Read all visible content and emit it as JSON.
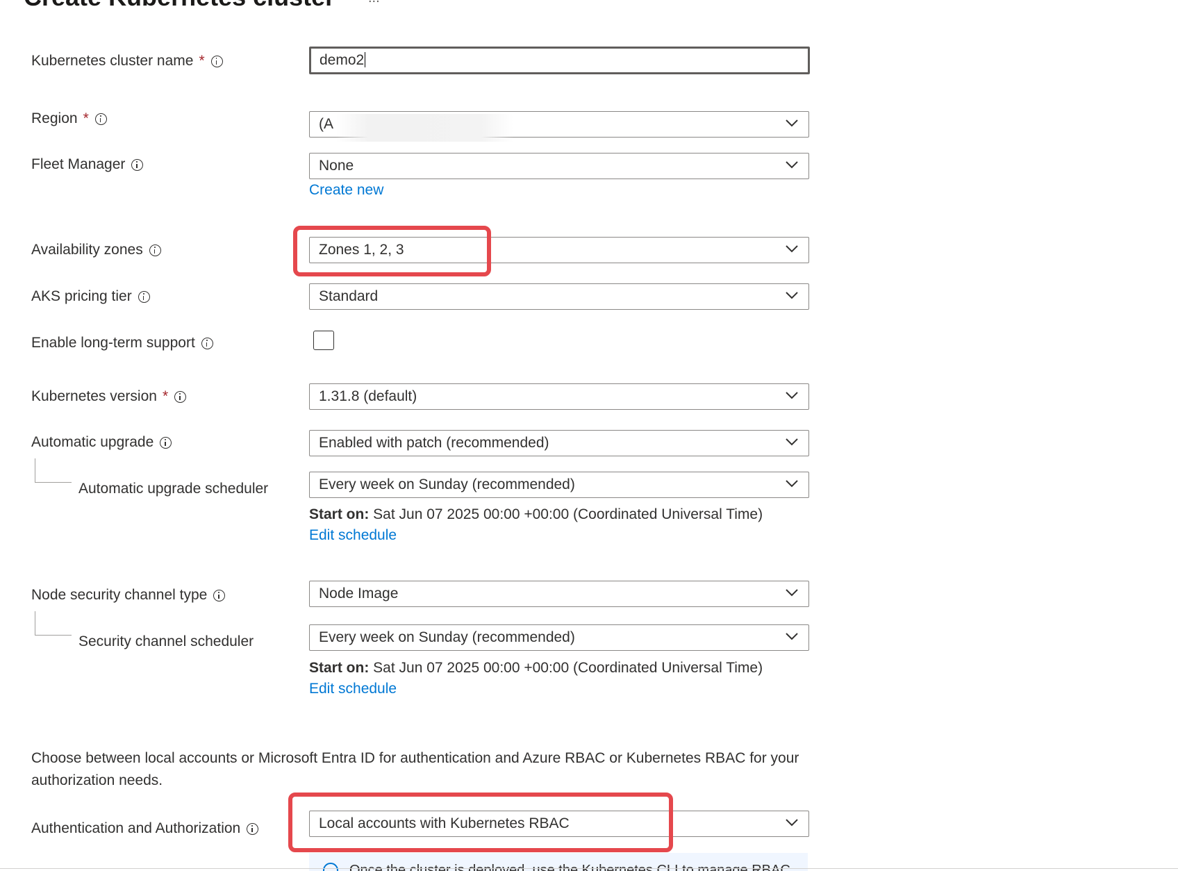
{
  "page": {
    "title": "Create Kubernetes cluster",
    "more_label": "..."
  },
  "fields": {
    "cluster_name": {
      "label": "Kubernetes cluster name",
      "required": "*",
      "value": "demo2"
    },
    "region": {
      "label": "Region",
      "required": "*",
      "value": "(A"
    },
    "fleet_manager": {
      "label": "Fleet Manager",
      "value": "None",
      "link": "Create new"
    },
    "availability_zones": {
      "label": "Availability zones",
      "value": "Zones 1, 2, 3"
    },
    "pricing_tier": {
      "label": "AKS pricing tier",
      "value": "Standard"
    },
    "long_term_support": {
      "label": "Enable long-term support",
      "checked": false
    },
    "k8s_version": {
      "label": "Kubernetes version",
      "required": "*",
      "value": "1.31.8 (default)"
    },
    "automatic_upgrade": {
      "label": "Automatic upgrade",
      "value": "Enabled with patch (recommended)"
    },
    "upgrade_scheduler": {
      "label": "Automatic upgrade scheduler",
      "value": "Every week on Sunday (recommended)",
      "start_label": "Start on:",
      "start_value": "Sat Jun 07 2025 00:00 +00:00 (Coordinated Universal Time)",
      "link": "Edit schedule"
    },
    "node_security_channel": {
      "label": "Node security channel type",
      "value": "Node Image"
    },
    "security_scheduler": {
      "label": "Security channel scheduler",
      "value": "Every week on Sunday (recommended)",
      "start_label": "Start on:",
      "start_value": "Sat Jun 07 2025 00:00 +00:00 (Coordinated Universal Time)",
      "link": "Edit schedule"
    },
    "auth_description": "Choose between local accounts or Microsoft Entra ID for authentication and Azure RBAC or Kubernetes RBAC for your authorization needs.",
    "authentication": {
      "label": "Authentication and Authorization",
      "value": "Local accounts with Kubernetes RBAC"
    },
    "info_banner": {
      "text": "Once the cluster is deployed, use the Kubernetes CLI to manage RBAC"
    }
  },
  "colors": {
    "link": "#0078d4",
    "required": "#a4262c",
    "highlight": "#e5484d"
  }
}
